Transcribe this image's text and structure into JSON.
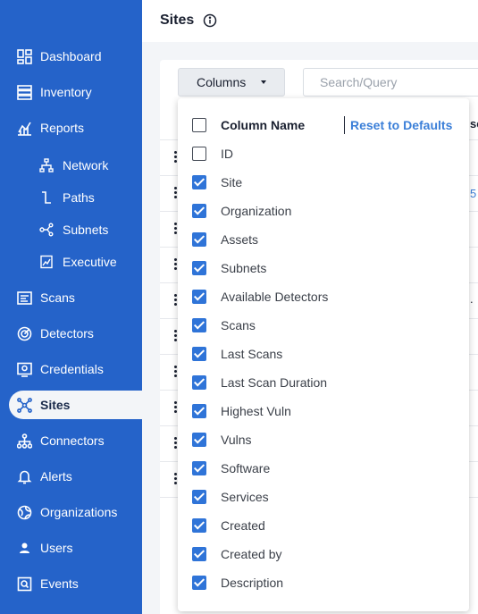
{
  "sidebar": {
    "items": [
      {
        "label": "Dashboard",
        "icon": "dashboard-icon"
      },
      {
        "label": "Inventory",
        "icon": "inventory-icon"
      },
      {
        "label": "Reports",
        "icon": "reports-icon"
      },
      {
        "label": "Network",
        "icon": "network-icon"
      },
      {
        "label": "Paths",
        "icon": "paths-icon"
      },
      {
        "label": "Subnets",
        "icon": "subnets-icon"
      },
      {
        "label": "Executive",
        "icon": "executive-icon"
      },
      {
        "label": "Scans",
        "icon": "scans-icon"
      },
      {
        "label": "Detectors",
        "icon": "detectors-icon"
      },
      {
        "label": "Credentials",
        "icon": "credentials-icon"
      },
      {
        "label": "Sites",
        "icon": "sites-icon",
        "active": true
      },
      {
        "label": "Connectors",
        "icon": "connectors-icon"
      },
      {
        "label": "Alerts",
        "icon": "bell-icon"
      },
      {
        "label": "Organizations",
        "icon": "globe-icon"
      },
      {
        "label": "Users",
        "icon": "user-icon"
      },
      {
        "label": "Events",
        "icon": "events-icon"
      }
    ]
  },
  "header": {
    "title": "Sites",
    "info_icon": "info-icon"
  },
  "toolbar": {
    "columns_label": "Columns",
    "search_placeholder": "Search/Query"
  },
  "peek": {
    "col_fragment": "se",
    "val_fragment": "5",
    "dot_fragment": "."
  },
  "column_menu": {
    "header_label": "Column Name",
    "reset_label": "Reset to Defaults",
    "options": [
      {
        "label": "ID",
        "checked": false
      },
      {
        "label": "Site",
        "checked": true
      },
      {
        "label": "Organization",
        "checked": true
      },
      {
        "label": "Assets",
        "checked": true
      },
      {
        "label": "Subnets",
        "checked": true
      },
      {
        "label": "Available Detectors",
        "checked": true
      },
      {
        "label": "Scans",
        "checked": true
      },
      {
        "label": "Last Scans",
        "checked": true
      },
      {
        "label": "Last Scan Duration",
        "checked": true
      },
      {
        "label": "Highest Vuln",
        "checked": true
      },
      {
        "label": "Vulns",
        "checked": true
      },
      {
        "label": "Software",
        "checked": true
      },
      {
        "label": "Services",
        "checked": true
      },
      {
        "label": "Created",
        "checked": true
      },
      {
        "label": "Created by",
        "checked": true
      },
      {
        "label": "Description",
        "checked": true
      }
    ]
  },
  "colors": {
    "sidebar": "#2563c9",
    "accent": "#2f74d8",
    "link": "#3b7fd8"
  }
}
